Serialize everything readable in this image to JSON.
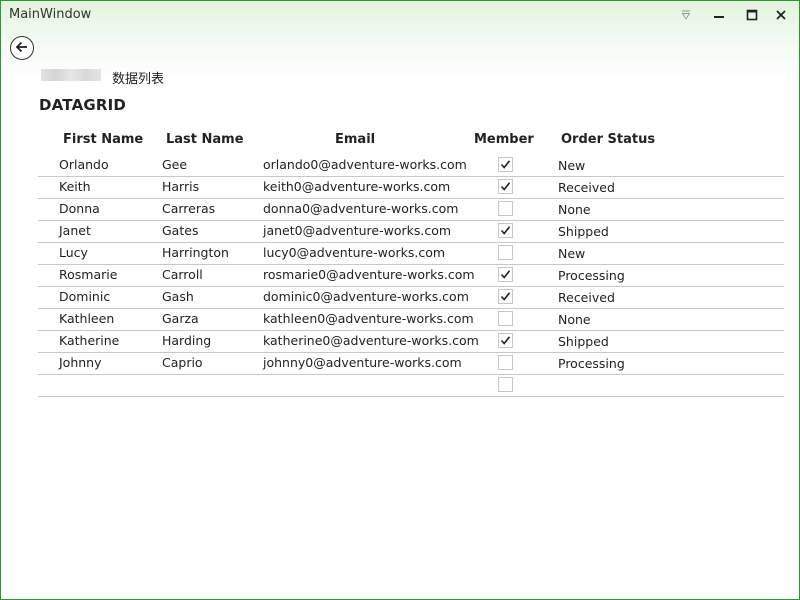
{
  "window": {
    "title": "MainWindow",
    "controls": [
      "caret-down-icon",
      "minimize-icon",
      "maximize-icon",
      "close-icon"
    ]
  },
  "page": {
    "subtitle": "数据列表",
    "grid_title": "DATAGRID"
  },
  "grid": {
    "columns": [
      "First Name",
      "Last Name",
      "Email",
      "Member",
      "Order Status"
    ],
    "rows": [
      {
        "first": "Orlando",
        "last": "Gee",
        "email": "orlando0@adventure-works.com",
        "member": true,
        "status": "New"
      },
      {
        "first": "Keith",
        "last": "Harris",
        "email": "keith0@adventure-works.com",
        "member": true,
        "status": "Received"
      },
      {
        "first": "Donna",
        "last": "Carreras",
        "email": "donna0@adventure-works.com",
        "member": false,
        "status": "None"
      },
      {
        "first": "Janet",
        "last": "Gates",
        "email": "janet0@adventure-works.com",
        "member": true,
        "status": "Shipped"
      },
      {
        "first": "Lucy",
        "last": "Harrington",
        "email": "lucy0@adventure-works.com",
        "member": false,
        "status": "New"
      },
      {
        "first": "Rosmarie",
        "last": "Carroll",
        "email": "rosmarie0@adventure-works.com",
        "member": true,
        "status": "Processing"
      },
      {
        "first": "Dominic",
        "last": "Gash",
        "email": "dominic0@adventure-works.com",
        "member": true,
        "status": "Received"
      },
      {
        "first": "Kathleen",
        "last": "Garza",
        "email": "kathleen0@adventure-works.com",
        "member": false,
        "status": "None"
      },
      {
        "first": "Katherine",
        "last": "Harding",
        "email": "katherine0@adventure-works.com",
        "member": true,
        "status": "Shipped"
      },
      {
        "first": "Johnny",
        "last": "Caprio",
        "email": "johnny0@adventure-works.com",
        "member": false,
        "status": "Processing"
      },
      {
        "first": "",
        "last": "",
        "email": "",
        "member": false,
        "status": ""
      }
    ]
  },
  "colors": {
    "window_border": "#2b9a2b",
    "row_divider": "#c8c8c8"
  }
}
